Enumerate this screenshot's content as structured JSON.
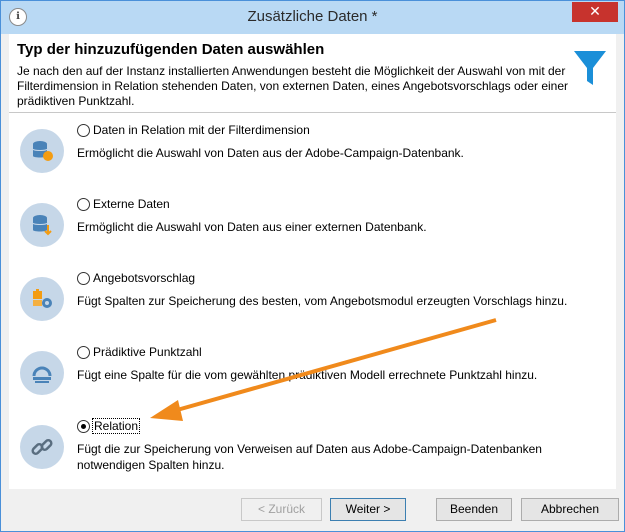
{
  "window": {
    "title": "Zusätzliche Daten *",
    "close_label": "✕"
  },
  "header": {
    "title": "Typ der hinzuzufügenden Daten auswählen",
    "description": "Je nach den auf der Instanz installierten Anwendungen besteht die Möglichkeit der Auswahl von mit der Filterdimension in Relation stehenden Daten, von externen Daten, eines Angebotsvorschlags oder einer prädiktiven Punktzahl."
  },
  "options": [
    {
      "label": "Daten in Relation mit der Filterdimension",
      "description": "Ermöglicht die Auswahl von Daten aus der Adobe-Campaign-Datenbank.",
      "checked": false
    },
    {
      "label": "Externe Daten",
      "description": "Ermöglicht die Auswahl von Daten aus einer externen Datenbank.",
      "checked": false
    },
    {
      "label": "Angebotsvorschlag",
      "description": "Fügt Spalten zur Speicherung des besten, vom Angebotsmodul erzeugten Vorschlags hinzu.",
      "checked": false
    },
    {
      "label": "Prädiktive Punktzahl",
      "description": "Fügt eine Spalte für die vom gewählten prädiktiven Modell errechnete Punktzahl hinzu.",
      "checked": false
    },
    {
      "label": "Relation",
      "description": "Fügt die zur Speicherung von Verweisen auf Daten aus Adobe-Campaign-Datenbanken notwendigen Spalten hinzu.",
      "checked": true
    }
  ],
  "buttons": {
    "back": "< Zurück",
    "next": "Weiter >",
    "finish": "Beenden",
    "cancel": "Abbrechen"
  },
  "colors": {
    "accent": "#1b8fd8",
    "annotation_arrow": "#f08a1c",
    "icon_bg": "#c6d7e8",
    "icon_fg": "#4a83b8"
  }
}
